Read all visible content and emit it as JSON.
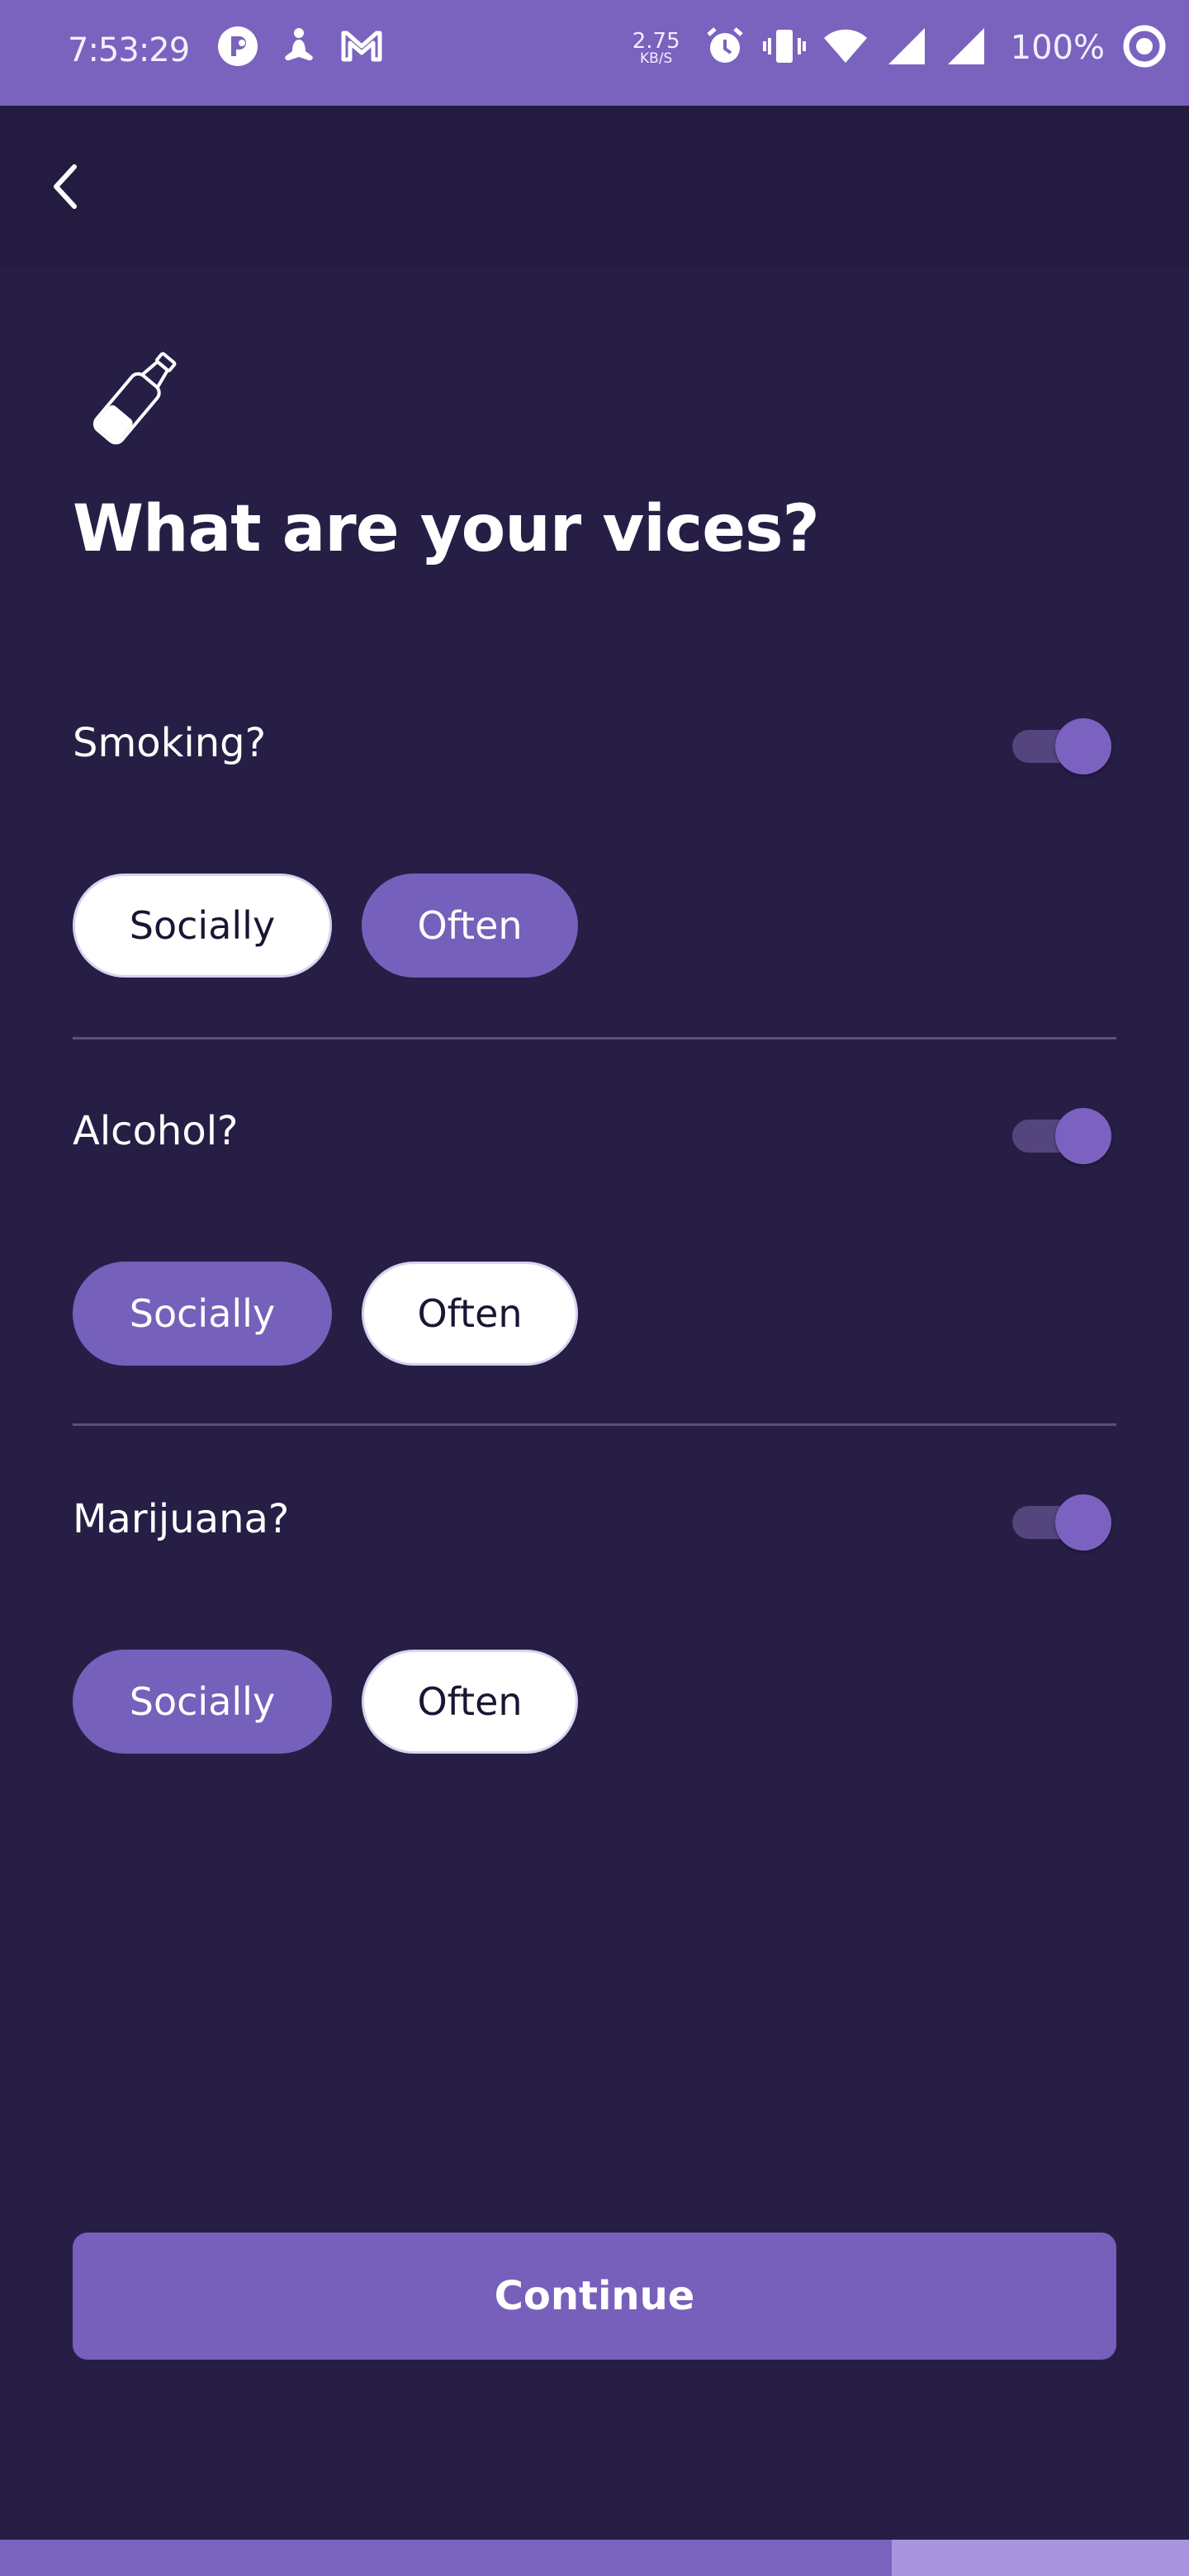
{
  "status_bar": {
    "time": "7:53:29",
    "speed_value": "2.75",
    "speed_unit": "KB/S",
    "battery": "100%"
  },
  "page": {
    "title": "What are your vices?",
    "icon": "bottle-icon"
  },
  "sections": [
    {
      "question": "Smoking?",
      "toggle_on": true,
      "options": [
        {
          "label": "Socially",
          "selected": false
        },
        {
          "label": "Often",
          "selected": true
        }
      ]
    },
    {
      "question": "Alcohol?",
      "toggle_on": true,
      "options": [
        {
          "label": "Socially",
          "selected": true
        },
        {
          "label": "Often",
          "selected": false
        }
      ]
    },
    {
      "question": "Marijuana?",
      "toggle_on": true,
      "options": [
        {
          "label": "Socially",
          "selected": true
        },
        {
          "label": "Often",
          "selected": false
        }
      ]
    }
  ],
  "continue_label": "Continue",
  "progress": 0.75,
  "colors": {
    "background": "#271e46",
    "accent": "#7560bb",
    "status_bar": "#7a63bf"
  }
}
